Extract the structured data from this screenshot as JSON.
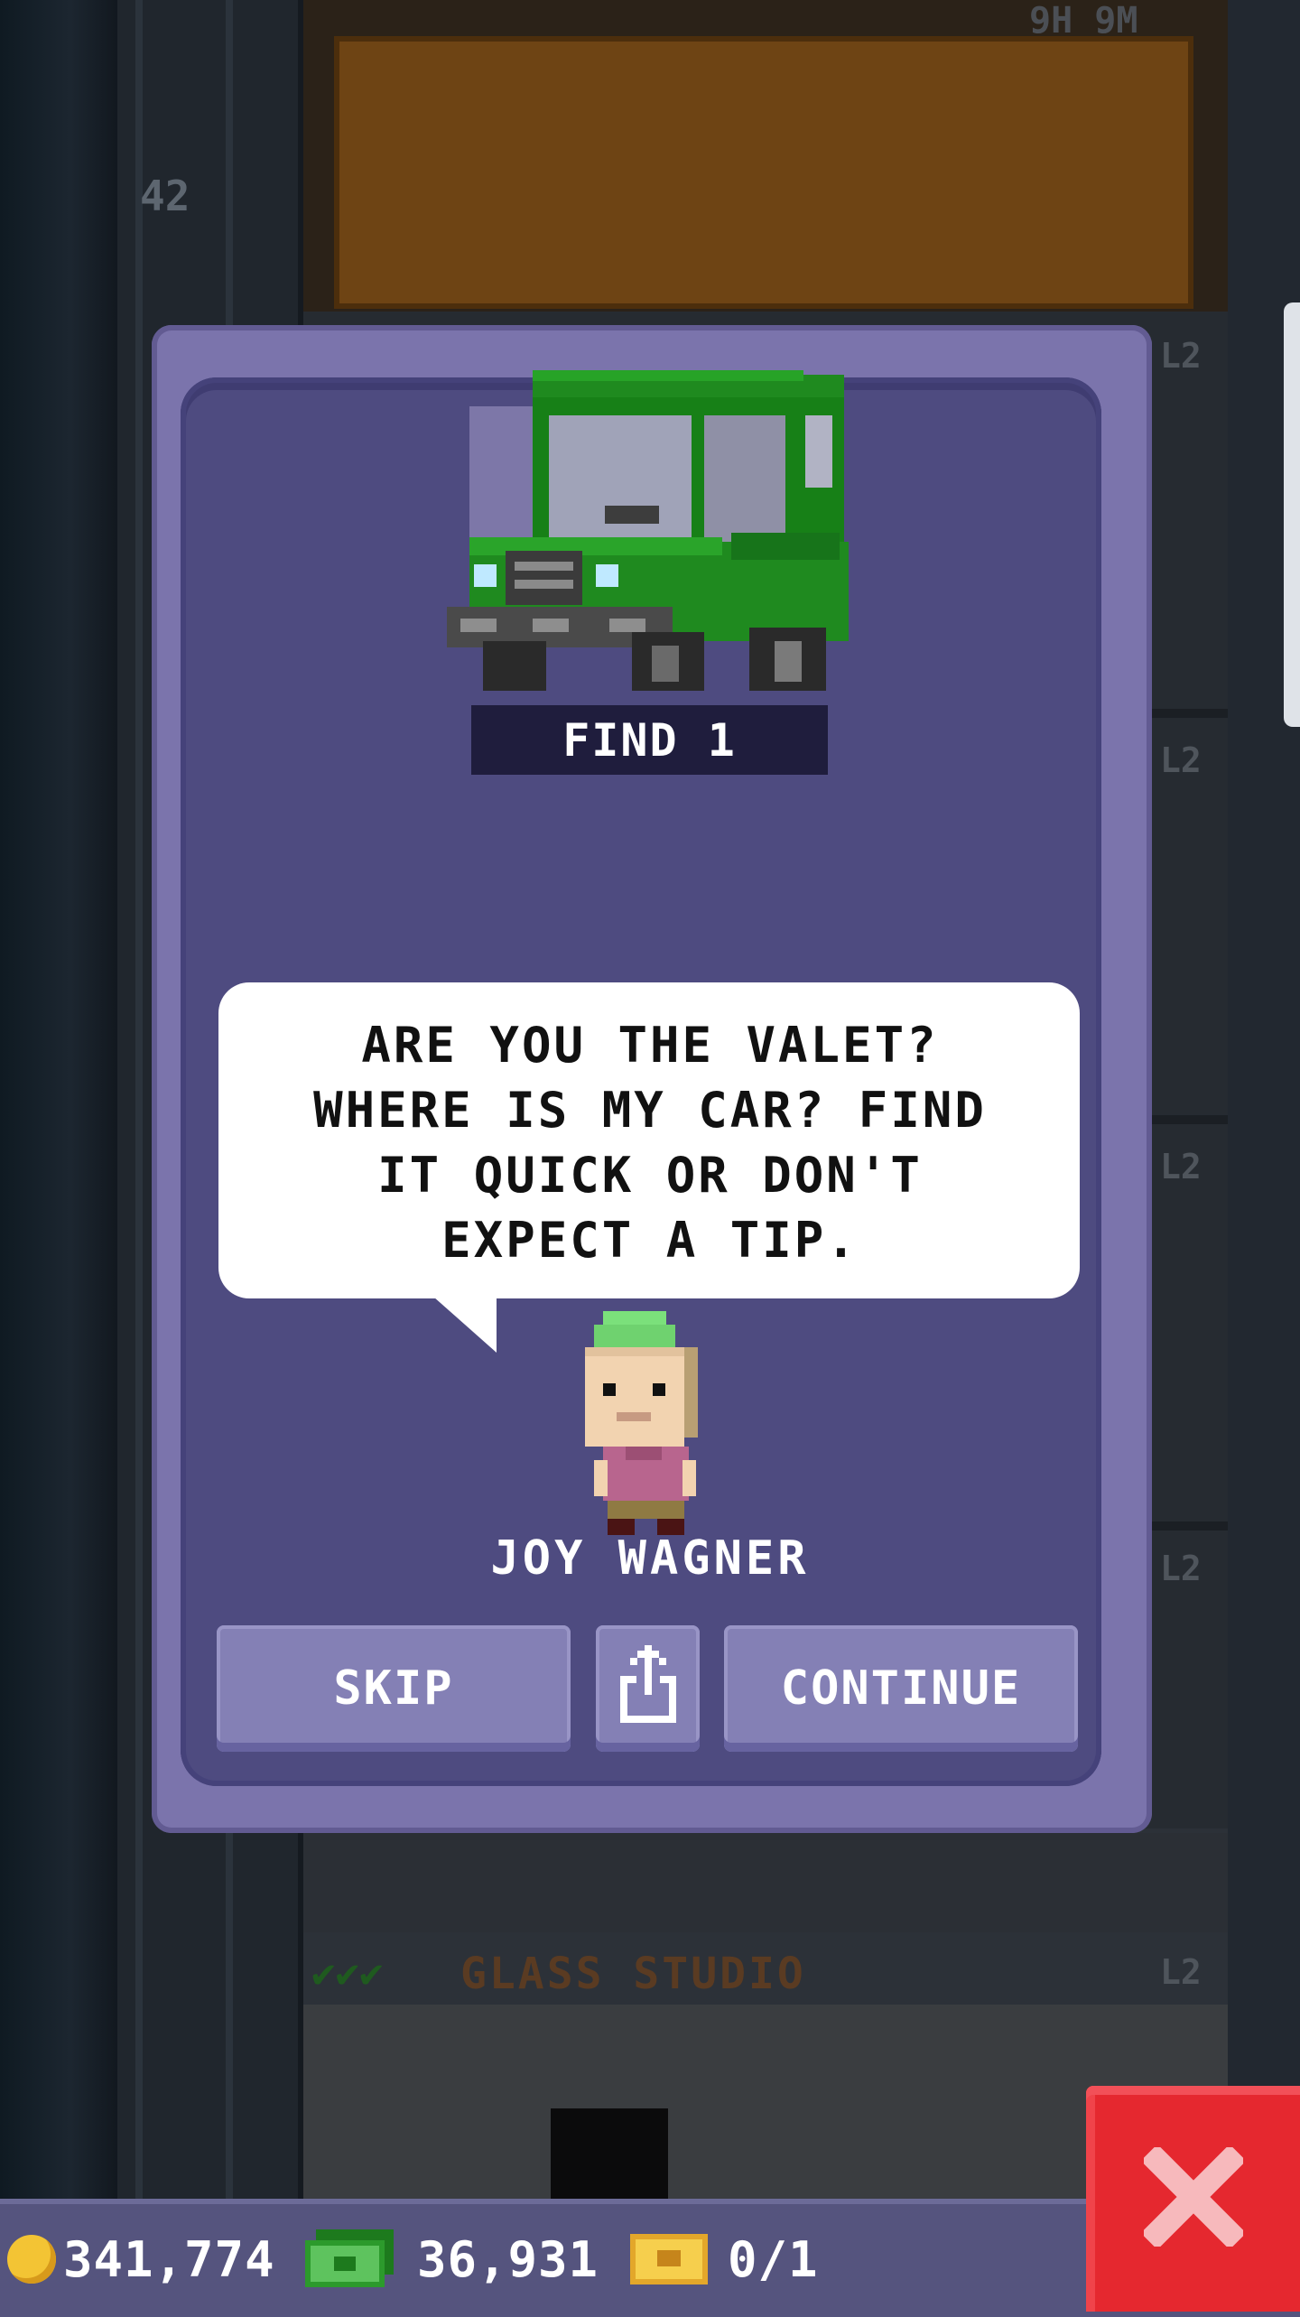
{
  "background": {
    "floor_number": "42",
    "timer": "9H 9M",
    "floor_levels": [
      "L2",
      "L2",
      "L2",
      "L2"
    ],
    "studio_checks": "✔✔✔",
    "studio_name": "GLASS STUDIO",
    "studio_level": "L2"
  },
  "dialog": {
    "vehicle_icon": "green-car-icon",
    "find_label": "FIND 1",
    "message": "ARE YOU THE VALET? WHERE IS MY CAR? FIND IT QUICK OR DON'T EXPECT A TIP.",
    "character_name": "JOY WAGNER",
    "buttons": {
      "skip": "SKIP",
      "share_icon": "share-icon",
      "continue": "CONTINUE"
    }
  },
  "status_bar": {
    "coins": "341,774",
    "bux": "36,931",
    "tickets": "0/1"
  },
  "colors": {
    "dialog_frame": "#7b74ac",
    "dialog_inner": "#4e4b80",
    "button": "#8480b5",
    "close_button": "#e5282f",
    "bottom_bar": "#55547e"
  }
}
